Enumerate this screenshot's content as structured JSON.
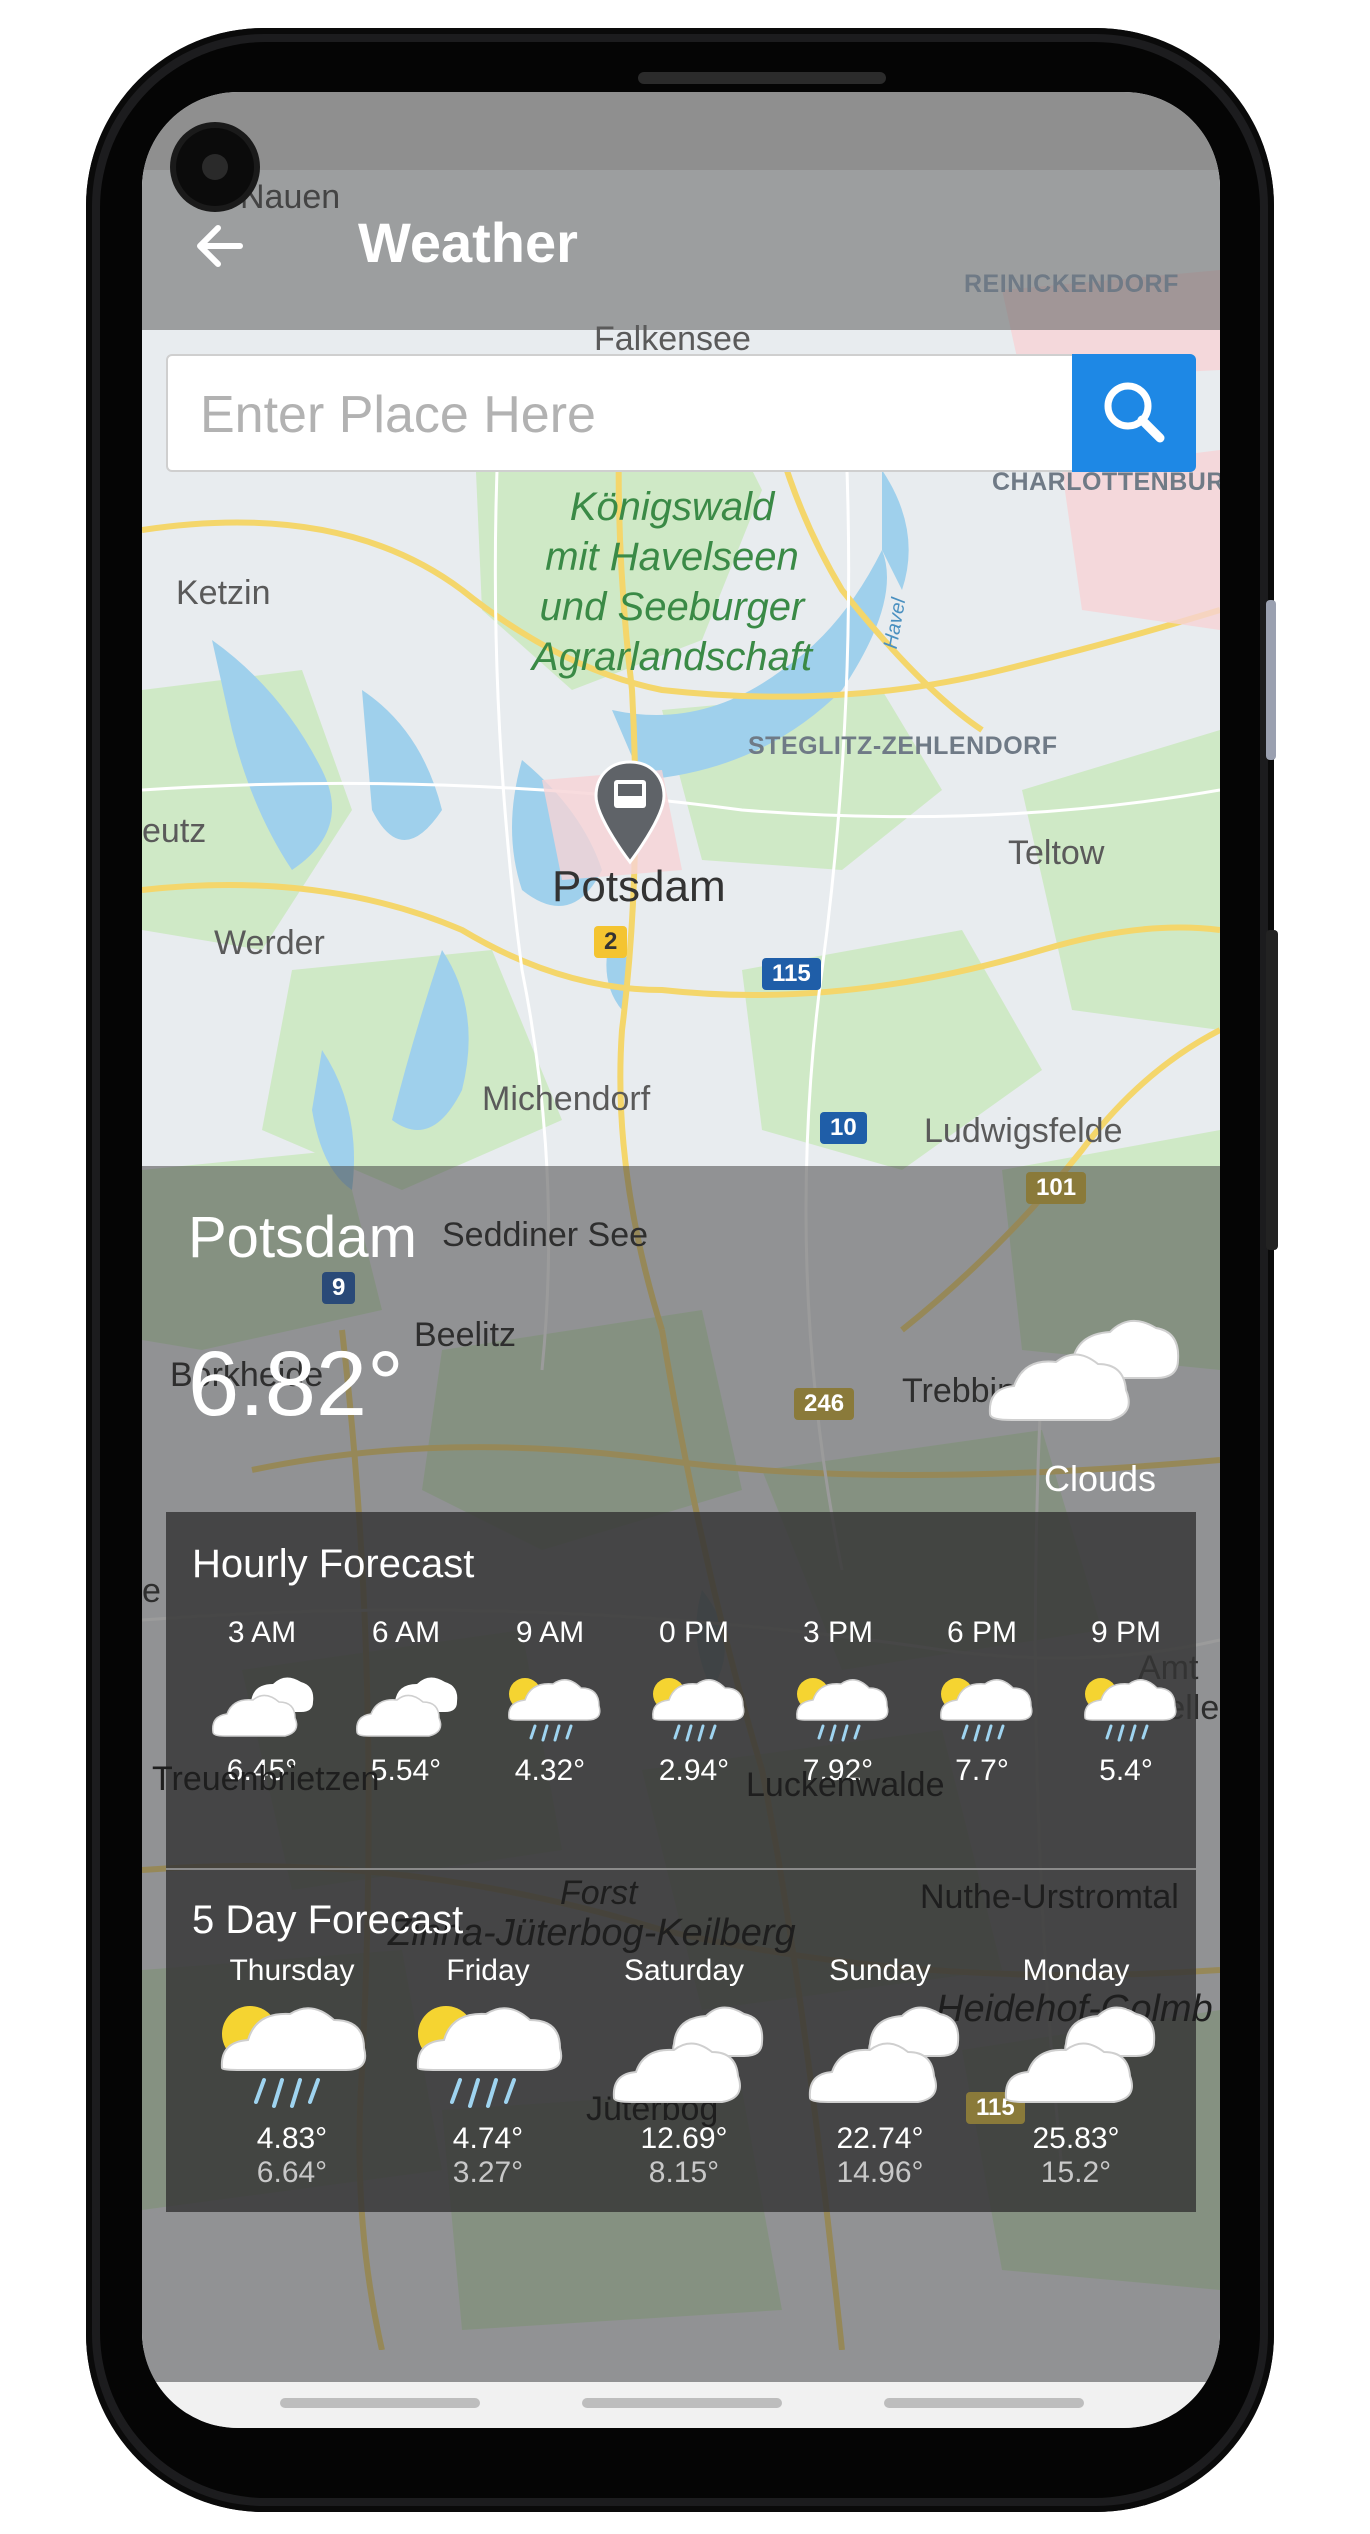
{
  "app": {
    "title": "Weather"
  },
  "search": {
    "placeholder": "Enter Place Here"
  },
  "map": {
    "labels": {
      "nauen": "Nauen",
      "falkensee": "Falkensee",
      "reinickendorf": "REINICKENDORF",
      "charlottenburg": "CHARLOTTENBURG",
      "ketzin": "Ketzin",
      "park": "Königswald\nmit Havelseen\nund Seeburger\nAgrarlandschaft",
      "havel": "Havel",
      "steglitz": "STEGLITZ-ZEHLENDORF",
      "eutz": "eutz",
      "potsdam": "Potsdam",
      "teltow": "Teltow",
      "werder": "Werder",
      "michendorf": "Michendorf",
      "ludwigsfelde": "Ludwigsfelde",
      "seddiner": "Seddiner See",
      "beelitz": "Beelitz",
      "borkheide": "Borkheide",
      "trebbin": "Trebbin",
      "treuenbrietzen": "Treuenbrietzen",
      "luckenwalde": "Luckenwalde",
      "forst": "Forst",
      "zinna": "Zinna-Jüterbog-Keilberg",
      "nuthe": "Nuthe-Urstromtal",
      "heidehof": "Heidehof-Golmb",
      "amt": "Amt\nMellen",
      "jueterbog": "Jüterbog",
      "e": "e"
    },
    "shields": {
      "r2": "2",
      "r115": "115",
      "r10": "10",
      "r101": "101",
      "r9": "9",
      "r246": "246",
      "r115b": "115"
    }
  },
  "current": {
    "city": "Potsdam",
    "temperature": "6.82°",
    "condition": "Clouds",
    "icon": "clouds-icon"
  },
  "hourly": {
    "heading": "Hourly Forecast",
    "items": [
      {
        "time": "3 AM",
        "temp": "6.45°",
        "icon": "clouds-icon"
      },
      {
        "time": "6 AM",
        "temp": "5.54°",
        "icon": "clouds-icon"
      },
      {
        "time": "9 AM",
        "temp": "4.32°",
        "icon": "rain-sun-icon"
      },
      {
        "time": "0 PM",
        "temp": "2.94°",
        "icon": "rain-sun-icon"
      },
      {
        "time": "3 PM",
        "temp": "7.92°",
        "icon": "rain-sun-icon"
      },
      {
        "time": "6 PM",
        "temp": "7.7°",
        "icon": "rain-sun-icon"
      },
      {
        "time": "9 PM",
        "temp": "5.4°",
        "icon": "rain-sun-icon"
      }
    ]
  },
  "daily": {
    "heading": "5 Day Forecast",
    "items": [
      {
        "day": "Thursday",
        "high": "4.83°",
        "low": "6.64°",
        "icon": "rain-sun-icon"
      },
      {
        "day": "Friday",
        "high": "4.74°",
        "low": "3.27°",
        "icon": "rain-sun-icon"
      },
      {
        "day": "Saturday",
        "high": "12.69°",
        "low": "8.15°",
        "icon": "clouds-icon"
      },
      {
        "day": "Sunday",
        "high": "22.74°",
        "low": "14.96°",
        "icon": "clouds-icon"
      },
      {
        "day": "Monday",
        "high": "25.83°",
        "low": "15.2°",
        "icon": "clouds-icon"
      }
    ]
  },
  "colors": {
    "accent": "#1e88e5",
    "appbar": "#6e6e6e"
  }
}
